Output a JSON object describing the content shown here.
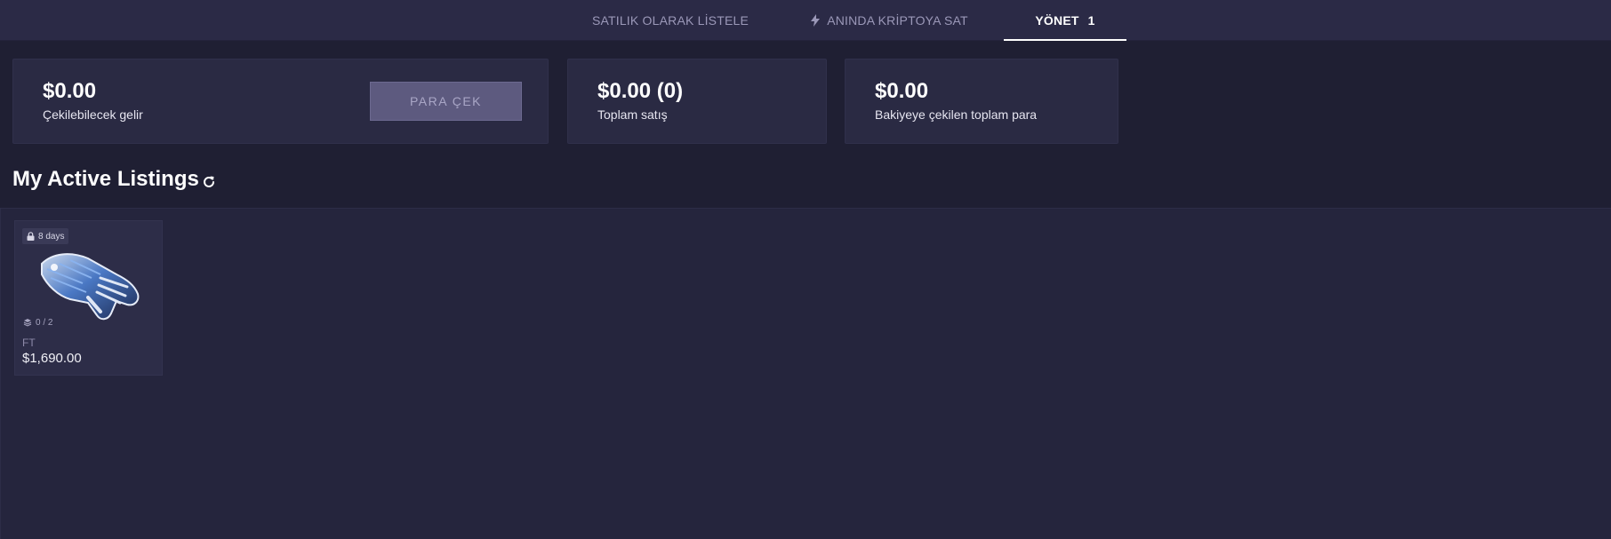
{
  "tabs": [
    {
      "label": "SATILIK OLARAK LİSTELE",
      "icon": null,
      "active": false
    },
    {
      "label": "ANINDA KRİPTOYA SAT",
      "icon": "lightning-icon",
      "active": false
    },
    {
      "label": "YÖNET",
      "count": "1",
      "active": true
    }
  ],
  "stats": {
    "withdrawable": {
      "value": "$0.00",
      "label": "Çekilebilecek gelir"
    },
    "withdraw_button": "PARA ÇEK",
    "total_sales": {
      "value": "$0.00 (0)",
      "label": "Toplam satış"
    },
    "withdrawn_to_balance": {
      "value": "$0.00",
      "label": "Bakiyeye çekilen toplam para"
    }
  },
  "listings": {
    "title": "My Active Listings",
    "refresh_icon": "refresh-icon",
    "items": [
      {
        "lock_text": "8 days",
        "lock_icon": "lock-icon",
        "stack_text": "0 / 2",
        "stack_icon": "layers-icon",
        "wear": "FT",
        "price": "$1,690.00",
        "image_icon": "glove-image"
      }
    ]
  },
  "colors": {
    "background": "#1f1f33",
    "topbar": "#2b2a46",
    "card": "#2a2a43",
    "button": "#5d5a7f",
    "active_tab": "#ffffff",
    "inactive_tab": "#9b98b8"
  }
}
